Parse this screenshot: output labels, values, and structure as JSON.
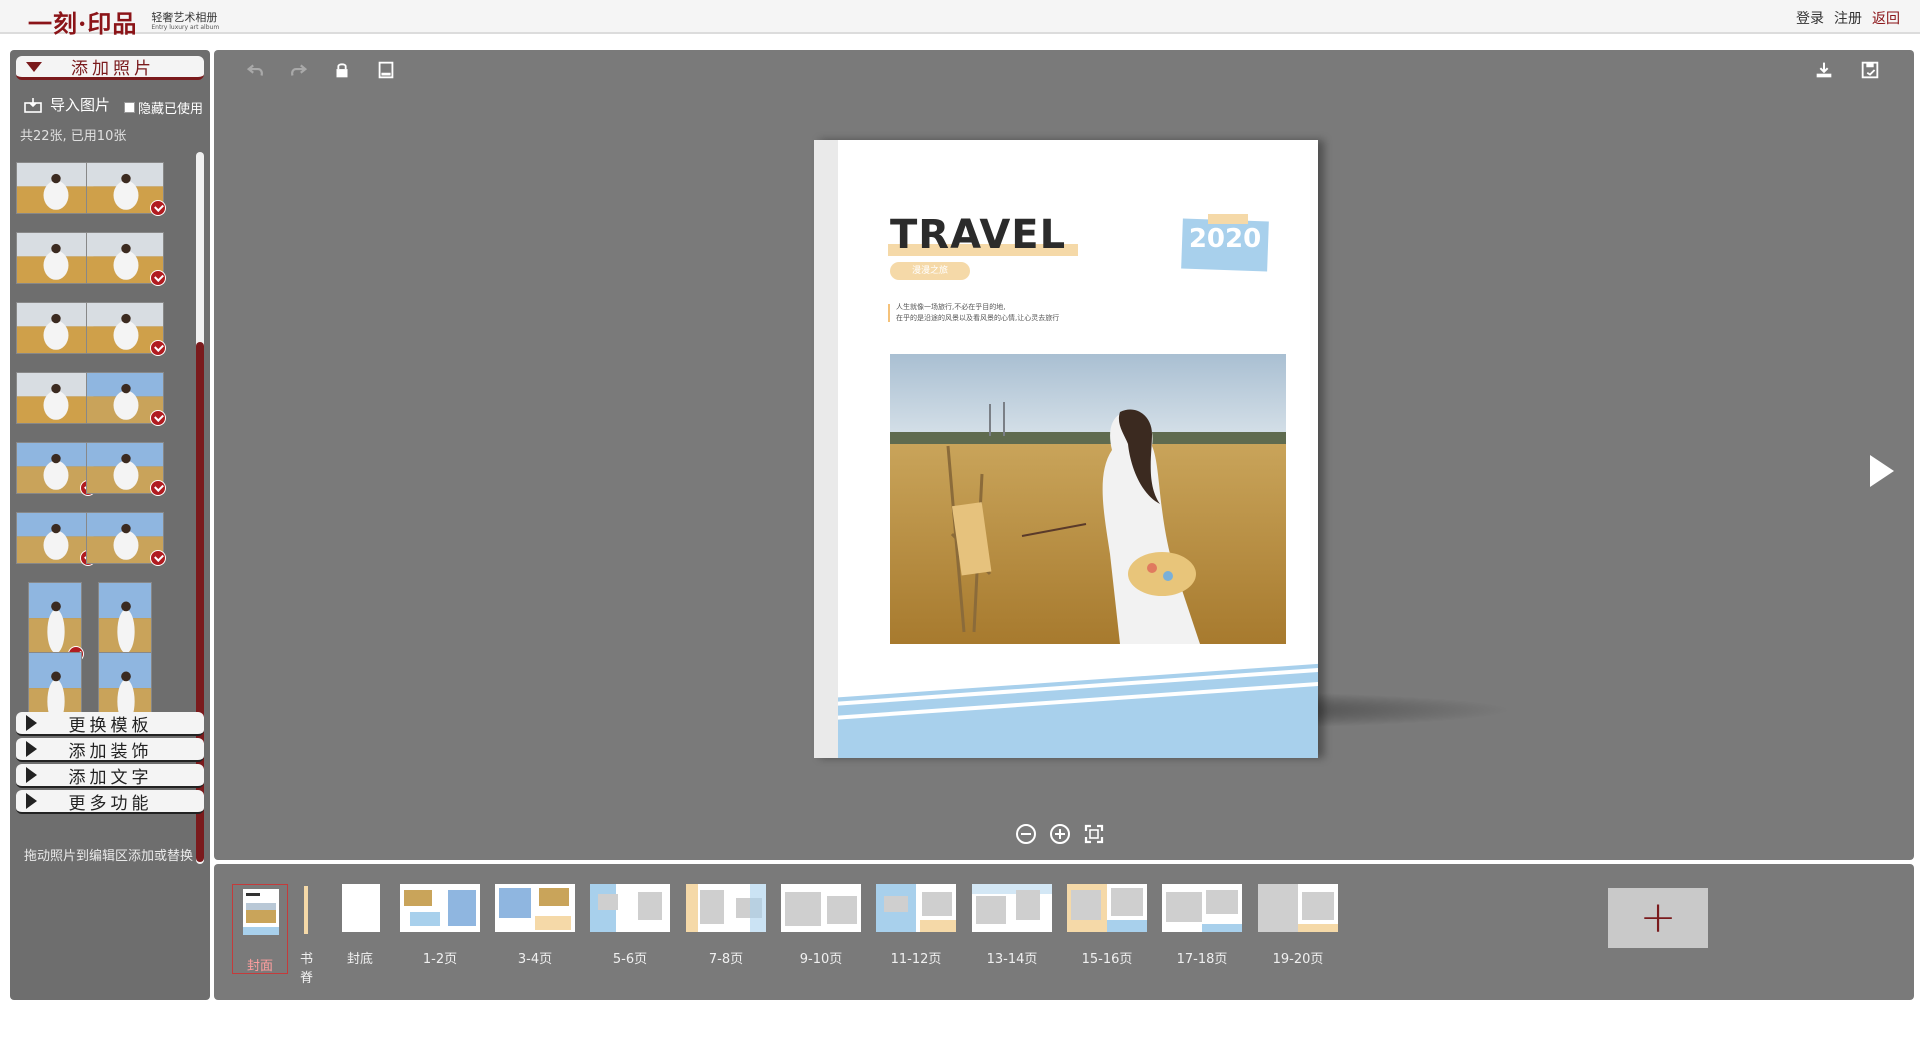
{
  "header": {
    "logo_main": "一刻·印品",
    "logo_sub_cn": "轻奢艺术相册",
    "logo_sub_en": "Entry luxury art album",
    "links": {
      "login": "登录",
      "register": "注册",
      "back": "返回"
    }
  },
  "left_panel": {
    "add_photos_label": "添加照片",
    "import_label": "导入图片",
    "hide_used_label": "隐藏已使用",
    "count_text": "共22张, 已用10张",
    "drag_hint": "拖动照片到编辑区添加或替换",
    "sections": [
      "更换模板",
      "添加装饰",
      "添加文字",
      "更多功能"
    ],
    "photos": [
      {
        "used": false,
        "tone": "warm"
      },
      {
        "used": true,
        "tone": "warm"
      },
      {
        "used": false,
        "tone": "warm"
      },
      {
        "used": true,
        "tone": "warm"
      },
      {
        "used": false,
        "tone": "warm"
      },
      {
        "used": true,
        "tone": "warm"
      },
      {
        "used": false,
        "tone": "warm"
      },
      {
        "used": true,
        "tone": "sky"
      },
      {
        "used": true,
        "tone": "sky"
      },
      {
        "used": true,
        "tone": "sky"
      },
      {
        "used": true,
        "tone": "sky"
      },
      {
        "used": true,
        "tone": "sky"
      },
      {
        "used": true,
        "tone": "sky"
      },
      {
        "used": false,
        "tone": "sky"
      },
      {
        "used": false,
        "tone": "sky"
      },
      {
        "used": false,
        "tone": "sky"
      }
    ]
  },
  "editor": {
    "cover": {
      "title": "TRAVEL",
      "pill_text": "漫漫之旅",
      "year": "2020",
      "desc_line1": "人生就像一场旅行,不必在乎目的地,",
      "desc_line2": "在乎的是沿途的风景以及看风景的心情,让心灵去旅行"
    }
  },
  "pages": [
    {
      "label": "封面",
      "active": true
    },
    {
      "label": "书脊",
      "active": false
    },
    {
      "label": "封底",
      "active": false
    },
    {
      "label": "1-2页",
      "active": false
    },
    {
      "label": "3-4页",
      "active": false
    },
    {
      "label": "5-6页",
      "active": false
    },
    {
      "label": "7-8页",
      "active": false
    },
    {
      "label": "9-10页",
      "active": false
    },
    {
      "label": "11-12页",
      "active": false
    },
    {
      "label": "13-14页",
      "active": false
    },
    {
      "label": "15-16页",
      "active": false
    },
    {
      "label": "17-18页",
      "active": false
    },
    {
      "label": "19-20页",
      "active": false
    }
  ],
  "colors": {
    "brand": "#8b1418",
    "panel_bg": "#6e6e6e",
    "editor_bg": "#7a7a7a",
    "cover_blue": "#a8d0ec",
    "cover_tan": "#f5d9a8"
  }
}
